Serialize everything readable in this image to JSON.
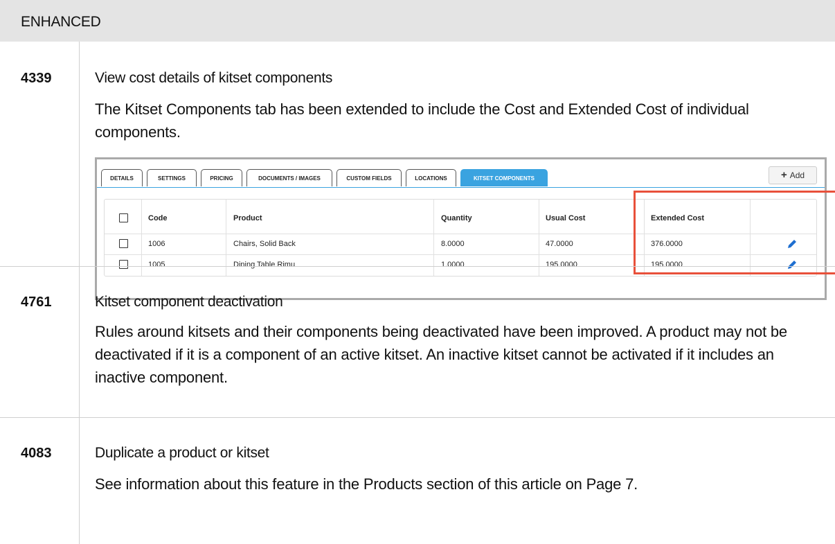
{
  "header": {
    "title": "ENHANCED"
  },
  "items": [
    {
      "id": "4339",
      "title": "View cost details of kitset components",
      "description": "The Kitset Components tab has been extended to include the Cost and Extended Cost of individual components."
    },
    {
      "id": "4761",
      "title": "Kitset component deactivation",
      "description": "Rules around kitsets and their components being deactivated have been improved. A product may not be deactivated if it is a component of an active kitset. An inactive kitset cannot be activated if it includes an inactive component."
    },
    {
      "id": "4083",
      "title": "Duplicate a product or kitset",
      "description": "See information about this feature in the Products section of this article on Page 7."
    }
  ],
  "screenshot": {
    "tabs": [
      "DETAILS",
      "SETTINGS",
      "PRICING",
      "DOCUMENTS / IMAGES",
      "CUSTOM FIELDS",
      "LOCATIONS",
      "KITSET COMPONENTS"
    ],
    "active_tab": "KITSET COMPONENTS",
    "add_label": "Add",
    "columns": [
      "Code",
      "Product",
      "Quantity",
      "Usual Cost",
      "Extended Cost"
    ],
    "rows": [
      {
        "code": "1006",
        "product": "Chairs, Solid Back",
        "quantity": "8.0000",
        "usual_cost": "47.0000",
        "extended_cost": "376.0000"
      },
      {
        "code": "1005",
        "product": "Dining Table Rimu",
        "quantity": "1.0000",
        "usual_cost": "195.0000",
        "extended_cost": "195.0000"
      }
    ],
    "colors": {
      "accent": "#3aa3e0",
      "highlight": "#e8503a",
      "edit_icon": "#1f6fd0"
    }
  }
}
